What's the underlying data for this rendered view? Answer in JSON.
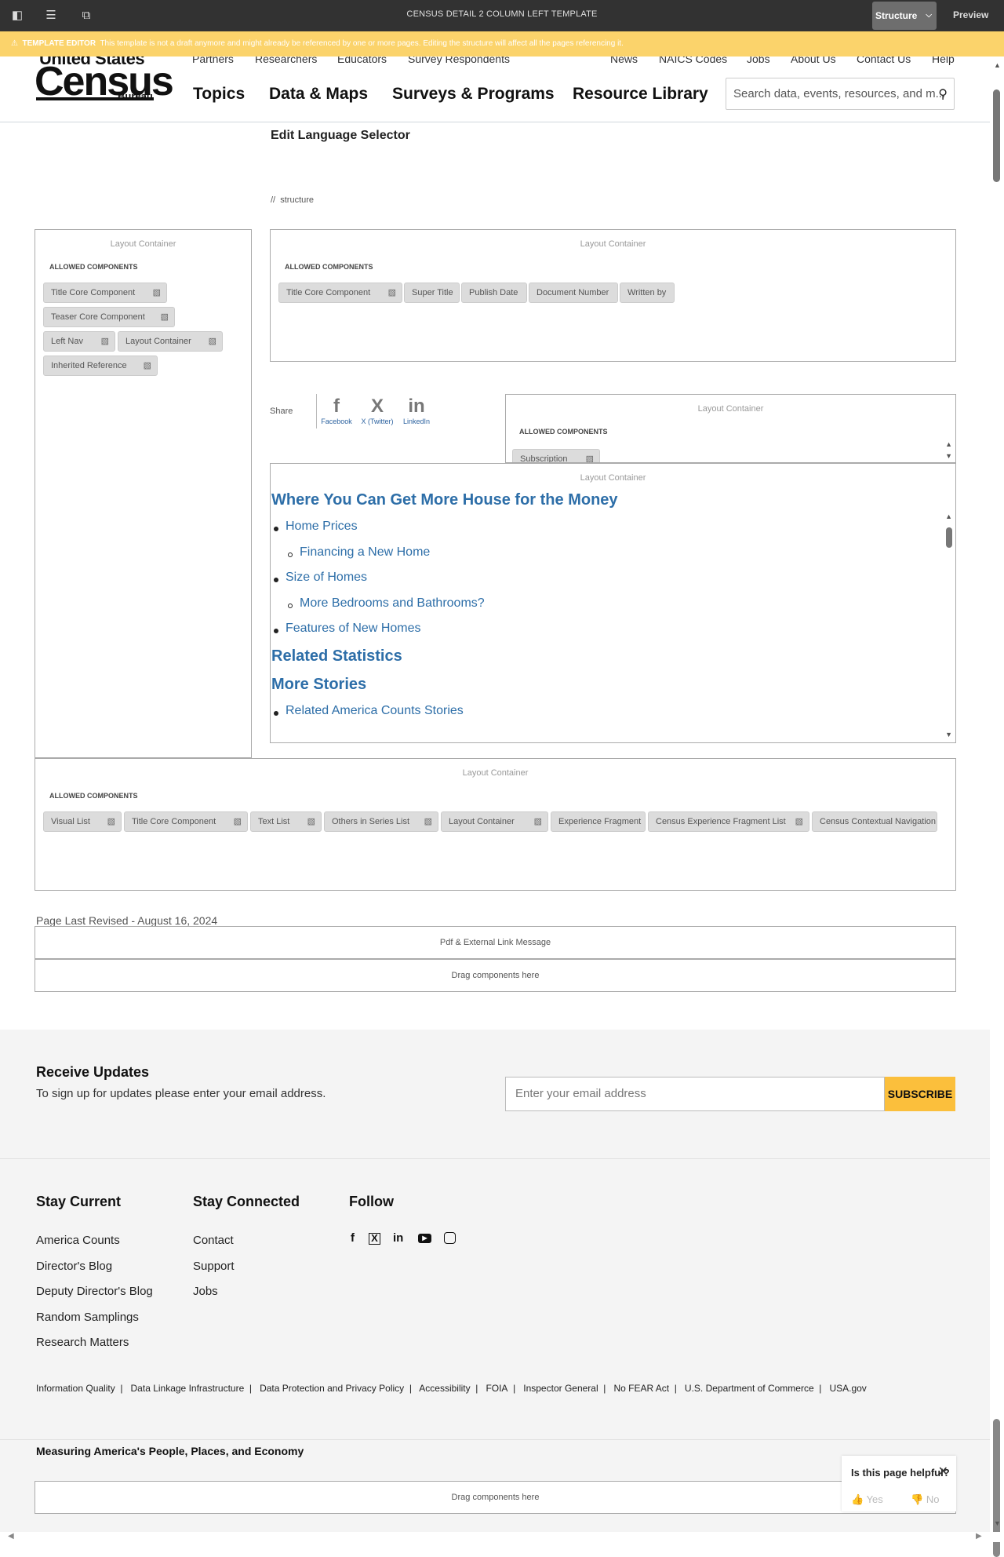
{
  "topbar": {
    "title": "CENSUS DETAIL 2 COLUMN LEFT TEMPLATE",
    "mode_label": "Structure",
    "preview_label": "Preview"
  },
  "warning": {
    "label": "TEMPLATE EDITOR",
    "text": "This template is not a draft anymore and might already be referenced by one or more pages. Editing the structure will affect all the pages referencing it."
  },
  "header": {
    "logo": {
      "top": "United States",
      "main": "Census",
      "bureau": "Bureau"
    },
    "utility_left": [
      "Partners",
      "Researchers",
      "Educators",
      "Survey Respondents"
    ],
    "utility_right": [
      "News",
      "NAICS Codes",
      "Jobs",
      "About Us",
      "Contact Us",
      "Help"
    ],
    "main_nav": [
      "Topics",
      "Data & Maps",
      "Surveys & Programs",
      "Resource Library"
    ],
    "search_placeholder": "Search data, events, resources, and m..."
  },
  "edit_language_selector": "Edit Language Selector",
  "breadcrumb": {
    "sep": "//",
    "text": "structure"
  },
  "containers": {
    "title": "Layout Container",
    "allowed_label": "ALLOWED COMPONENTS",
    "left": [
      "Title Core Component",
      "Teaser Core Component",
      "Left Nav",
      "Layout Container",
      "Inherited Reference"
    ],
    "top_right": [
      "Title Core Component",
      "Super Title",
      "Publish Date",
      "Document Number",
      "Written by"
    ],
    "share_box": [
      "Subscription"
    ],
    "bottom": [
      "Visual List",
      "Title Core Component",
      "Text List",
      "Others in Series List",
      "Layout Container",
      "Experience Fragment",
      "Census Experience Fragment List",
      "Census Contextual Navigation"
    ]
  },
  "share": {
    "label": "Share",
    "items": [
      {
        "name": "Facebook",
        "glyph": "f"
      },
      {
        "name": "X (Twitter)",
        "glyph": "X"
      },
      {
        "name": "LinkedIn",
        "glyph": "in"
      }
    ]
  },
  "toc": {
    "heading1": "Where You Can Get More House for the Money",
    "items": [
      {
        "text": "Home Prices",
        "level": 1
      },
      {
        "text": "Financing a New Home",
        "level": 2
      },
      {
        "text": "Size of Homes",
        "level": 1
      },
      {
        "text": "More Bedrooms and Bathrooms?",
        "level": 2
      },
      {
        "text": "Features of New Homes",
        "level": 1
      }
    ],
    "heading2": "Related Statistics",
    "heading3": "More Stories",
    "items2": [
      {
        "text": "Related America Counts Stories",
        "level": 1
      }
    ]
  },
  "page_revised": "Page Last Revised - August 16, 2024",
  "pdf_message": "Pdf & External Link Message",
  "drag_here": "Drag components here",
  "updates": {
    "title": "Receive Updates",
    "subtitle": "To sign up for updates please enter your email address.",
    "email_placeholder": "Enter your email address",
    "subscribe_label": "SUBSCRIBE"
  },
  "footer": {
    "stay_current": {
      "title": "Stay Current",
      "links": [
        "America Counts",
        "Director's Blog",
        "Deputy Director's Blog",
        "Random Samplings",
        "Research Matters"
      ]
    },
    "stay_connected": {
      "title": "Stay Connected",
      "links": [
        "Contact",
        "Support",
        "Jobs"
      ]
    },
    "follow": {
      "title": "Follow",
      "icons": [
        "facebook-icon",
        "x-icon",
        "linkedin-icon",
        "youtube-icon",
        "instagram-icon"
      ]
    },
    "legal": [
      "Information Quality",
      "Data Linkage Infrastructure",
      "Data Protection and Privacy Policy",
      "Accessibility",
      "FOIA",
      "Inspector General",
      "No FEAR Act",
      "U.S. Department of Commerce",
      "USA.gov"
    ],
    "mission": "Measuring America's People, Places, and Economy"
  },
  "helpful": {
    "question": "Is this page helpful?",
    "yes": "Yes",
    "no": "No"
  },
  "colors": {
    "accent_link": "#2d6ea8",
    "subscribe": "#fbbf3c",
    "warning": "#fbd36b",
    "topbar": "#323232"
  }
}
